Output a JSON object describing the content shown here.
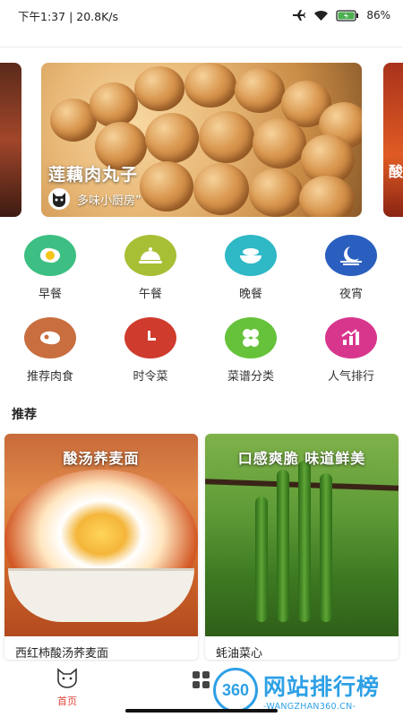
{
  "status_bar": {
    "time": "下午1:37",
    "speed": "20.8K/s",
    "battery": "86",
    "battery_unit": "%"
  },
  "banner": {
    "title": "莲藕肉丸子",
    "author": "多味小厨房”",
    "side_right_label": "酸"
  },
  "categories": [
    {
      "label": "早餐",
      "icon": "fried-egg-icon",
      "color": "#3dbf83"
    },
    {
      "label": "午餐",
      "icon": "cloche-icon",
      "color": "#a7bf35"
    },
    {
      "label": "晚餐",
      "icon": "bowl-icon",
      "color": "#2fb8c5"
    },
    {
      "label": "夜宵",
      "icon": "moon-icon",
      "color": "#2b5fbf"
    },
    {
      "label": "推荐肉食",
      "icon": "steak-icon",
      "color": "#c86e3f"
    },
    {
      "label": "时令菜",
      "icon": "clock-icon",
      "color": "#cf3b2d"
    },
    {
      "label": "菜谱分类",
      "icon": "clover-icon",
      "color": "#66c23a"
    },
    {
      "label": "人气排行",
      "icon": "ranking-icon",
      "color": "#d8368d"
    }
  ],
  "recommend": {
    "title": "推荐",
    "cards": [
      {
        "caption": "酸汤荞麦面",
        "name": "西红柿酸汤荞麦面"
      },
      {
        "caption": "口感爽脆 味道鲜美",
        "name": "蚝油菜心"
      }
    ]
  },
  "bottom_nav": {
    "home_label": "首页"
  },
  "watermark": {
    "logo": "360",
    "main": "网站排行榜",
    "sub": "-WANGZHAN360.CN-"
  }
}
